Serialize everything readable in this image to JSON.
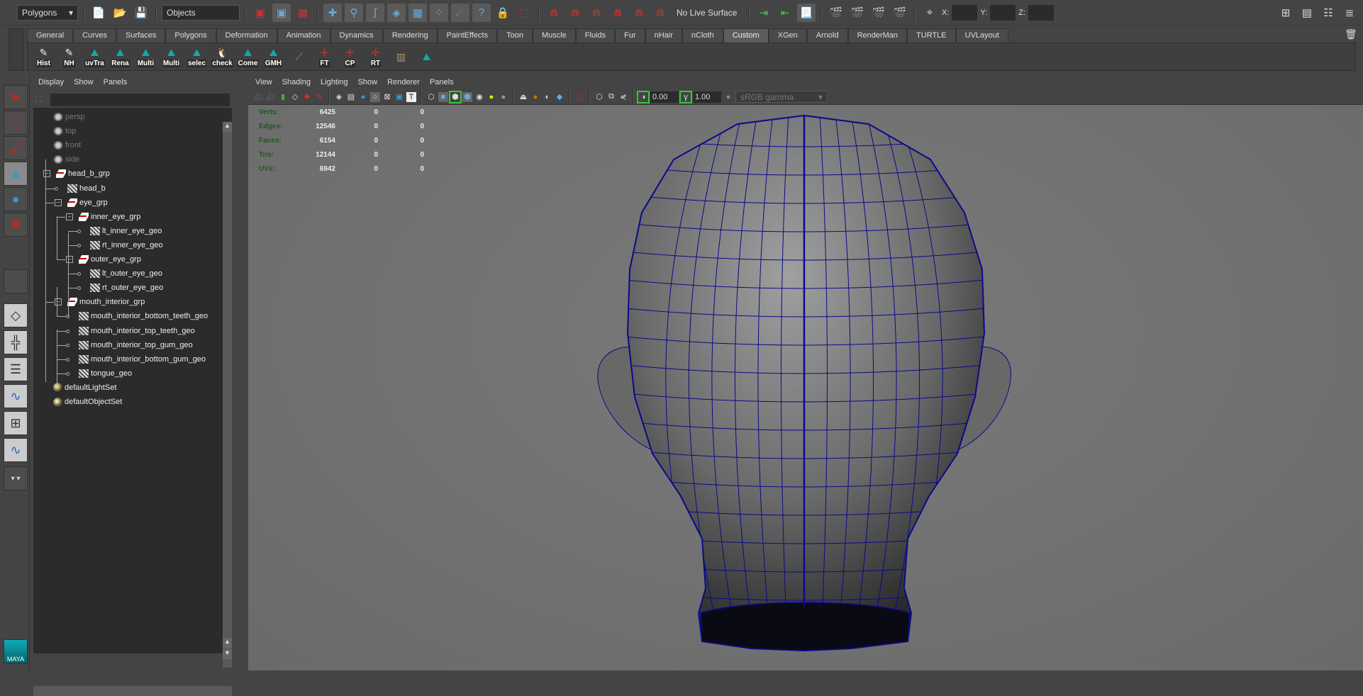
{
  "statusline": {
    "mode": "Polygons",
    "selection_mode": "Objects",
    "live_surface": "No Live Surface",
    "x_label": "X:",
    "y_label": "Y:",
    "z_label": "Z:"
  },
  "shelf": {
    "tabs": [
      "General",
      "Curves",
      "Surfaces",
      "Polygons",
      "Deformation",
      "Animation",
      "Dynamics",
      "Rendering",
      "PaintEffects",
      "Toon",
      "Muscle",
      "Fluids",
      "Fur",
      "nHair",
      "nCloth",
      "Custom",
      "XGen",
      "Arnold",
      "RenderMan",
      "TURTLE",
      "UVLayout"
    ],
    "active_tab": "Custom",
    "buttons": [
      "Hist",
      "NH",
      "uvTra",
      "Rena",
      "Multi",
      "Multi",
      "selec",
      "check",
      "Come",
      "GMH",
      "",
      "FT",
      "CP",
      "RT",
      "",
      ""
    ]
  },
  "outliner": {
    "menu": [
      "Display",
      "Show",
      "Panels"
    ],
    "filter": "",
    "items": [
      {
        "label": "persp",
        "type": "cam",
        "depth": 0
      },
      {
        "label": "top",
        "type": "cam",
        "depth": 0
      },
      {
        "label": "front",
        "type": "cam",
        "depth": 0
      },
      {
        "label": "side",
        "type": "cam",
        "depth": 0
      },
      {
        "label": "head_b_grp",
        "type": "grp",
        "depth": 0
      },
      {
        "label": "head_b",
        "type": "mesh",
        "depth": 1
      },
      {
        "label": "eye_grp",
        "type": "grp",
        "depth": 1
      },
      {
        "label": "inner_eye_grp",
        "type": "grp",
        "depth": 2
      },
      {
        "label": "lt_inner_eye_geo",
        "type": "mesh",
        "depth": 3
      },
      {
        "label": "rt_inner_eye_geo",
        "type": "mesh",
        "depth": 3
      },
      {
        "label": "outer_eye_grp",
        "type": "grp",
        "depth": 2
      },
      {
        "label": "lt_outer_eye_geo",
        "type": "mesh",
        "depth": 3
      },
      {
        "label": "rt_outer_eye_geo",
        "type": "mesh",
        "depth": 3
      },
      {
        "label": "mouth_interior_grp",
        "type": "grp",
        "depth": 1
      },
      {
        "label": "mouth_interior_bottom_teeth_geo",
        "type": "mesh",
        "depth": 2
      },
      {
        "label": "mouth_interior_top_teeth_geo",
        "type": "mesh",
        "depth": 2
      },
      {
        "label": "mouth_interior_top_gum_geo",
        "type": "mesh",
        "depth": 2
      },
      {
        "label": "mouth_interior_bottom_gum_geo",
        "type": "mesh",
        "depth": 2
      },
      {
        "label": "tongue_geo",
        "type": "mesh",
        "depth": 2
      },
      {
        "label": "defaultLightSet",
        "type": "set",
        "depth": 0
      },
      {
        "label": "defaultObjectSet",
        "type": "set",
        "depth": 0
      }
    ]
  },
  "viewport": {
    "menu": [
      "View",
      "Shading",
      "Lighting",
      "Show",
      "Renderer",
      "Panels"
    ],
    "exposure": "0.00",
    "gamma": "1.00",
    "color_space": "sRGB gamma",
    "hud": [
      {
        "label": "Verts:",
        "values": [
          "6425",
          "0",
          "0"
        ]
      },
      {
        "label": "Edges:",
        "values": [
          "12546",
          "0",
          "0"
        ]
      },
      {
        "label": "Faces:",
        "values": [
          "6154",
          "0",
          "0"
        ]
      },
      {
        "label": "Tris:",
        "values": [
          "12144",
          "0",
          "0"
        ]
      },
      {
        "label": "UVs:",
        "values": [
          "6942",
          "0",
          "0"
        ]
      }
    ]
  },
  "colors": {
    "wire": "#0a0a8a",
    "hud_label": "#1d5a1d"
  }
}
